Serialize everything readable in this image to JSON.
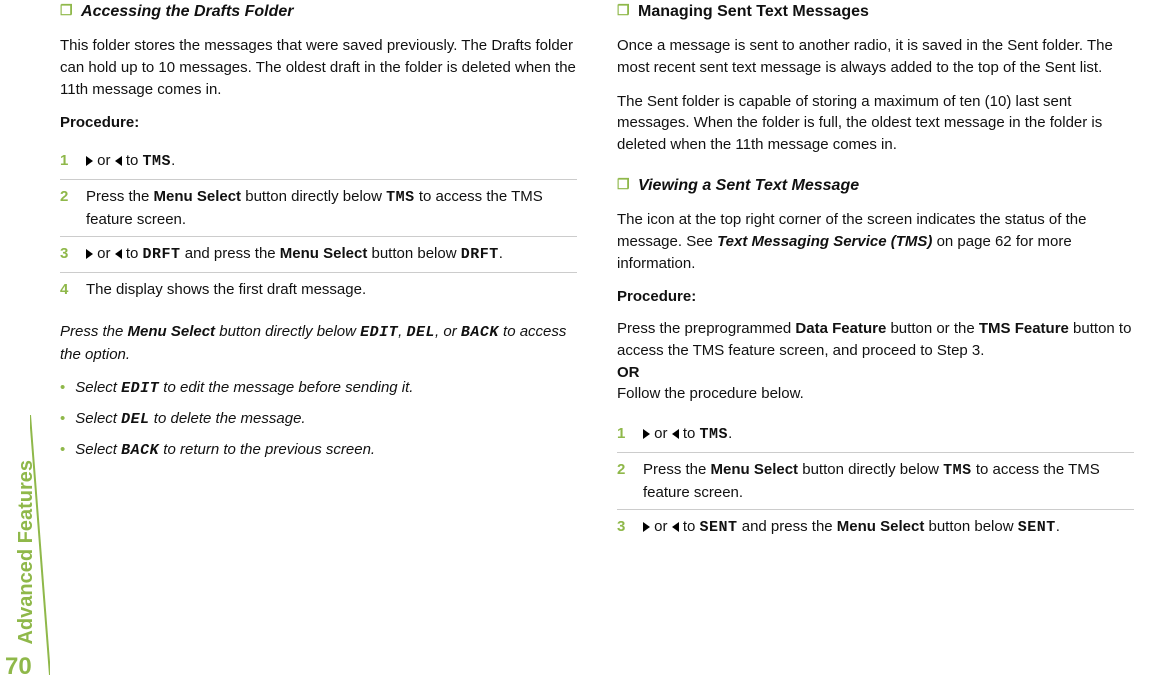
{
  "sidebar": {
    "section": "Advanced Features",
    "page": "70"
  },
  "left": {
    "title": "Accessing the Drafts Folder",
    "intro": "This folder stores the messages that were saved previously. The Drafts folder can hold up to 10 messages. The oldest draft in the folder is deleted when the 11th message comes in.",
    "procedure_label": "Procedure:",
    "steps": {
      "s1_or": " or ",
      "s1_to": " to ",
      "s1_tms": "TMS",
      "s1_end": ".",
      "s2_a": "Press the ",
      "s2_menu": "Menu Select",
      "s2_b": " button directly below ",
      "s2_tms": "TMS",
      "s2_c": " to access the TMS feature screen.",
      "s3_or": " or ",
      "s3_to": " to ",
      "s3_drft": "DRFT",
      "s3_and": " and press the ",
      "s3_menu": "Menu Select",
      "s3_btn": " button below ",
      "s3_drft2": "DRFT",
      "s3_end": ".",
      "s4": "The display shows the first draft message."
    },
    "note_a": "Press the ",
    "note_menu": "Menu Select",
    "note_b": " button directly below ",
    "note_edit": "EDIT",
    "note_com1": ", ",
    "note_del": "DEL",
    "note_or": ", or ",
    "note_back": "BACK",
    "note_c": " to access the option.",
    "b1a": "Select ",
    "b1_edit": "EDIT",
    "b1b": " to edit the message before sending it.",
    "b2a": "Select ",
    "b2_del": "DEL",
    "b2b": " to delete the message.",
    "b3a": "Select ",
    "b3_back": "BACK",
    "b3b": " to return to the previous screen."
  },
  "right": {
    "title1": "Managing Sent Text Messages",
    "p1": "Once a message is sent to another radio, it is saved in the Sent folder. The most recent sent text message is always added to the top of the Sent list.",
    "p2": "The Sent folder is capable of storing a maximum of ten (10) last sent messages. When the folder is full, the oldest text message in the folder is deleted when the 11th message comes in.",
    "title2": "Viewing a Sent Text Message",
    "p3a": "The icon at the top right corner of the screen indicates the status of the message. See ",
    "p3b": "Text Messaging Service (TMS)",
    "p3c": " on page 62 for more information.",
    "procedure_label": "Procedure:",
    "p4a": "Press the preprogrammed ",
    "p4_df": "Data Feature",
    "p4b": " button or the ",
    "p4_tms": "TMS Feature",
    "p4c": " button to access the TMS feature screen, and proceed to Step 3.",
    "p4_or": "OR",
    "p4_follow": "Follow the procedure below.",
    "steps": {
      "s1_or": " or ",
      "s1_to": " to ",
      "s1_tms": "TMS",
      "s1_end": ".",
      "s2_a": "Press the ",
      "s2_menu": "Menu Select",
      "s2_b": " button directly below ",
      "s2_tms": "TMS",
      "s2_c": " to access the TMS feature screen.",
      "s3_or": " or ",
      "s3_to": " to ",
      "s3_sent": "SENT",
      "s3_and": " and press the ",
      "s3_menu": "Menu Select",
      "s3_btn": " button below ",
      "s3_sent2": "SENT",
      "s3_end": "."
    }
  }
}
